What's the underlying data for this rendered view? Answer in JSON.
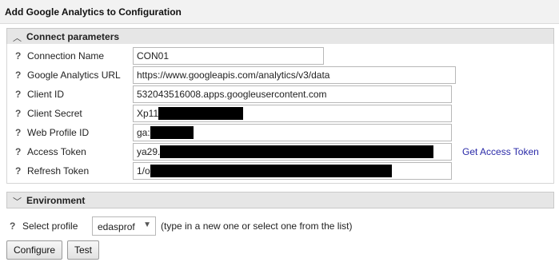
{
  "title": "Add Google Analytics to Configuration",
  "sections": {
    "connect": {
      "label": "Connect parameters",
      "collapse_icon": "chevron-up-icon"
    },
    "environment": {
      "label": "Environment",
      "collapse_icon": "chevron-down-icon"
    }
  },
  "help_glyph": "?",
  "fields": {
    "connection_name": {
      "label": "Connection Name",
      "value": "CON01"
    },
    "ga_url": {
      "label": "Google Analytics URL",
      "value": "https://www.googleapis.com/analytics/v3/data"
    },
    "client_id": {
      "label": "Client ID",
      "value": "532043516008.apps.googleusercontent.com"
    },
    "client_secret": {
      "label": "Client Secret",
      "value": "Xp11"
    },
    "web_profile_id": {
      "label": "Web Profile ID",
      "value": "ga:"
    },
    "access_token": {
      "label": "Access Token",
      "value": "ya29."
    },
    "refresh_token": {
      "label": "Refresh Token",
      "value": "1/o"
    }
  },
  "get_access_token_link": "Get Access Token",
  "environment": {
    "select_label": "Select profile",
    "selected_profile": "edasprof",
    "hint": "(type in a new one or select one from the list)"
  },
  "buttons": {
    "configure": "Configure",
    "test": "Test"
  },
  "colors": {
    "link": "#2a2aa8",
    "header_bg": "#e6e6e6",
    "redaction": "#000000"
  }
}
